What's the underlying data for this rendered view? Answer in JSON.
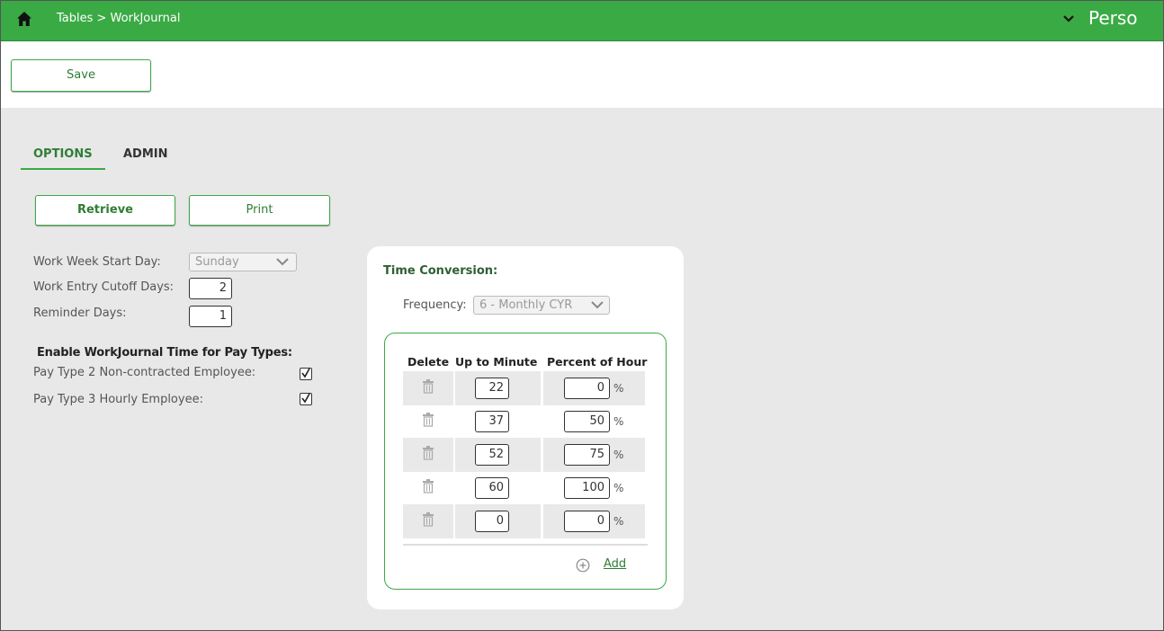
{
  "header": {
    "breadcrumb": "Tables > WorkJournal",
    "module_title": "Perso",
    "bar_color": "#3aaa45"
  },
  "toolbar": {
    "save_label": "Save"
  },
  "tabs": [
    {
      "label": "OPTIONS",
      "active": true
    },
    {
      "label": "ADMIN",
      "active": false
    }
  ],
  "actions": {
    "retrieve_label": "Retrieve",
    "print_label": "Print"
  },
  "options": {
    "work_week_start_day": {
      "label": "Work Week Start Day:",
      "value": "Sunday"
    },
    "work_entry_cutoff_days": {
      "label": "Work Entry Cutoff Days:",
      "value": "2"
    },
    "reminder_days": {
      "label": "Reminder Days:",
      "value": "1"
    },
    "pay_types_heading": "Enable WorkJournal Time for Pay Types:",
    "pay_types": [
      {
        "label": "Pay Type 2 Non-contracted Employee:",
        "checked": true
      },
      {
        "label": "Pay Type 3 Hourly Employee:",
        "checked": true
      }
    ]
  },
  "time_conversion": {
    "title": "Time Conversion:",
    "frequency_label": "Frequency:",
    "frequency_value": "6 - Monthly CYR",
    "columns": [
      "Delete",
      "Up to Minute",
      "Percent of Hour"
    ],
    "rows": [
      {
        "minute": "22",
        "percent": "0"
      },
      {
        "minute": "37",
        "percent": "50"
      },
      {
        "minute": "52",
        "percent": "75"
      },
      {
        "minute": "60",
        "percent": "100"
      },
      {
        "minute": "0",
        "percent": "0"
      }
    ],
    "percent_symbol": "%",
    "add_label": "Add"
  }
}
